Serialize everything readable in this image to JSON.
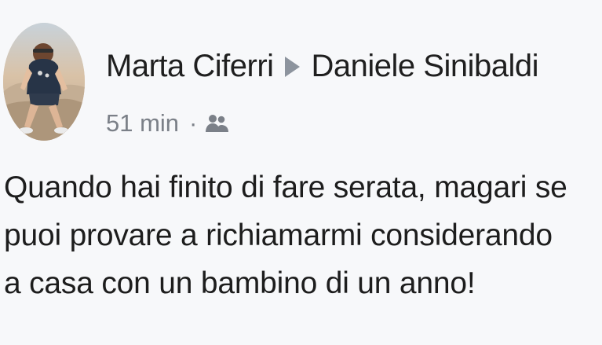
{
  "post": {
    "author": "Marta Ciferri",
    "target": "Daniele Sinibaldi",
    "time": "51 min",
    "separator": "·",
    "audience_icon": "friends-icon",
    "text_lines": [
      "Quando hai finito di fare serata, magari se",
      "puoi provare a richiamarmi considerando",
      "a casa con un bambino di un anno!"
    ]
  },
  "colors": {
    "name": "#1f1f1f",
    "meta": "#7b8088",
    "arrow": "#8d949e",
    "background": "#f7f8fa"
  }
}
